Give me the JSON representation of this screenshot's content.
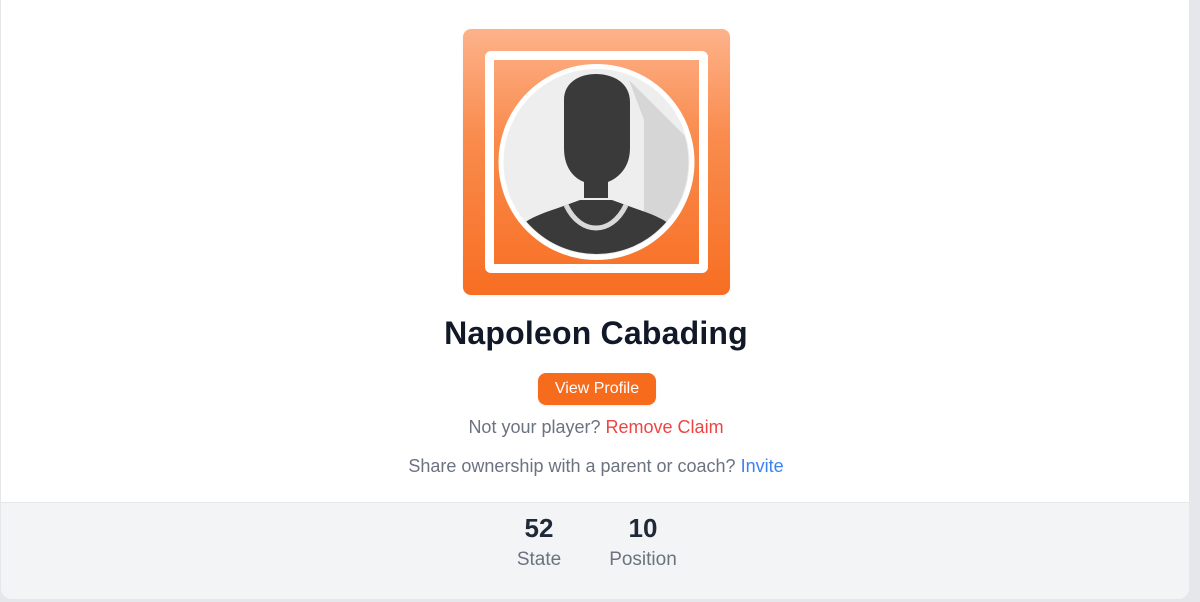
{
  "player": {
    "name": "Napoleon Cabading",
    "avatar_icon": "default-person-silhouette-icon",
    "avatar_gradient_top": "#fdb28a",
    "avatar_gradient_bottom": "#f76e22"
  },
  "actions": {
    "view_profile_label": "View Profile",
    "view_profile_color": "#f76b1c"
  },
  "claim": {
    "prompt": "Not your player?",
    "remove_label": "Remove Claim",
    "remove_color": "#ef4444"
  },
  "share": {
    "prompt": "Share ownership with a parent or coach?",
    "invite_label": "Invite",
    "invite_color": "#3b82f6"
  },
  "stats": [
    {
      "value": "52",
      "label": "State"
    },
    {
      "value": "10",
      "label": "Position"
    }
  ]
}
